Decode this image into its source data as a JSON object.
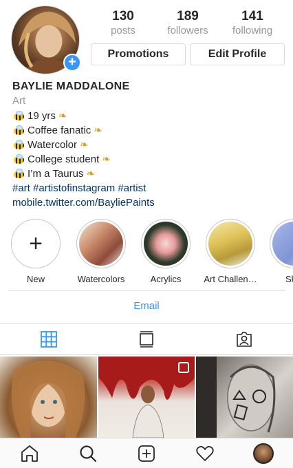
{
  "profile": {
    "stats": [
      {
        "value": "130",
        "label": "posts"
      },
      {
        "value": "189",
        "label": "followers"
      },
      {
        "value": "141",
        "label": "following"
      }
    ],
    "promotions_label": "Promotions",
    "edit_profile_label": "Edit Profile",
    "name": "BAYLIE MADDALONE",
    "category": "Art",
    "bio_lines": [
      "19 yrs",
      "Coffee fanatic",
      "Watercolor",
      "College student",
      "I’m a Taurus"
    ],
    "hashtags": "#art #artistofinstagram #artist",
    "link": "mobile.twitter.com/BayliePaints"
  },
  "highlights": [
    {
      "label": "New",
      "icon": "plus-icon"
    },
    {
      "label": "Watercolors"
    },
    {
      "label": "Acrylics"
    },
    {
      "label": "Art Challen…"
    },
    {
      "label": "Sket"
    }
  ],
  "email_label": "Email",
  "tabs": [
    {
      "icon": "grid-icon",
      "active": true
    },
    {
      "icon": "feed-icon",
      "active": false
    },
    {
      "icon": "tagged-icon",
      "active": false
    }
  ],
  "bottom_nav": [
    "home-icon",
    "search-icon",
    "new-post-icon",
    "activity-icon",
    "profile-avatar"
  ],
  "colors": {
    "accent": "#3897f0",
    "link": "#003569",
    "muted": "#999999"
  }
}
